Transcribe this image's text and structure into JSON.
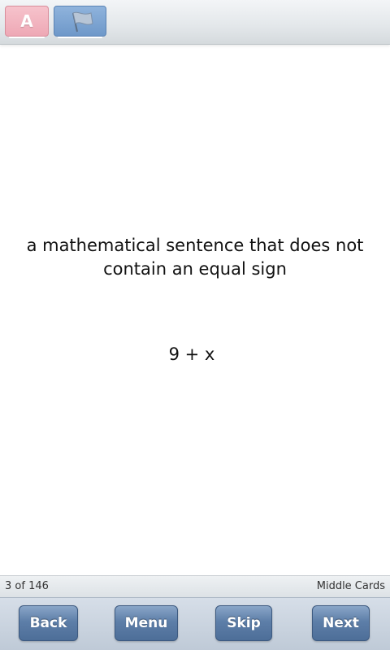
{
  "toolbar": {
    "font_button_label": "A",
    "font_button_color": "#eea8b5",
    "flag_button_icon": "flag-icon",
    "flag_button_color": "#6e98c9"
  },
  "card": {
    "question": "a mathematical sentence that does not contain an equal sign",
    "answer": "9 + x"
  },
  "status": {
    "progress": "3 of 146",
    "deck_name": "Middle Cards"
  },
  "nav": {
    "back_label": "Back",
    "menu_label": "Menu",
    "skip_label": "Skip",
    "next_label": "Next"
  }
}
